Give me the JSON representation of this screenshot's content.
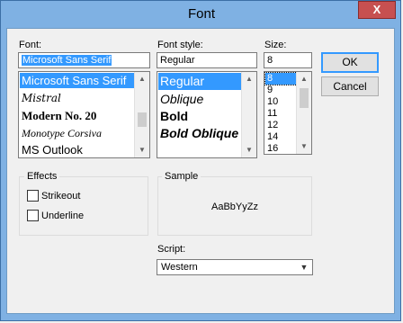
{
  "window": {
    "title": "Font",
    "close_glyph": "X"
  },
  "font": {
    "label": "Font:",
    "value": "Microsoft Sans Serif",
    "items": [
      "Microsoft Sans Serif",
      "Mistral",
      "Modern No. 20",
      "Monotype Corsiva",
      "MS Outlook"
    ]
  },
  "style": {
    "label": "Font style:",
    "value": "Regular",
    "items": [
      "Regular",
      "Oblique",
      "Bold",
      "Bold Oblique"
    ]
  },
  "size": {
    "label": "Size:",
    "value": "8",
    "items": [
      "8",
      "9",
      "10",
      "11",
      "12",
      "14",
      "16"
    ]
  },
  "buttons": {
    "ok": "OK",
    "cancel": "Cancel"
  },
  "effects": {
    "title": "Effects",
    "strikeout": "Strikeout",
    "underline": "Underline"
  },
  "sample": {
    "title": "Sample",
    "text": "AaBbYyZz"
  },
  "script": {
    "label": "Script:",
    "value": "Western"
  },
  "icons": {
    "scroll_up": "▲",
    "scroll_down": "▼",
    "dropdown": "▼"
  }
}
